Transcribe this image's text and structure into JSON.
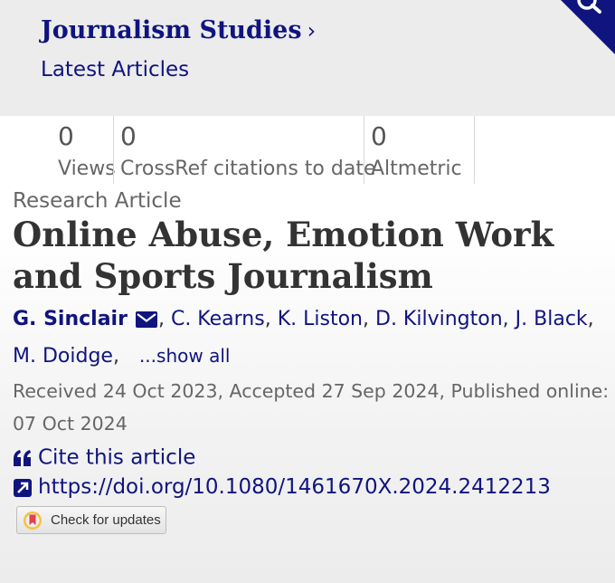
{
  "header": {
    "journal_title": "Journalism Studies",
    "journal_chevron": "›",
    "latest_articles": "Latest Articles"
  },
  "metrics": [
    {
      "value": "0",
      "label": "Views"
    },
    {
      "value": "0",
      "label": "CrossRef citations to date"
    },
    {
      "value": "0",
      "label": "Altmetric"
    }
  ],
  "article": {
    "type": "Research Article",
    "title": "Online Abuse, Emotion Work and Sports Journalism",
    "authors": [
      "G. Sinclair",
      "C. Kearns",
      "K. Liston",
      "D. Kilvington",
      "J. Black",
      "M. Doidge"
    ],
    "separator": ",",
    "show_all": "...show all",
    "dates": "Received 24 Oct 2023, Accepted 27 Sep 2024, Published online: 07 Oct 2024",
    "cite_label": "Cite this article",
    "doi": "https://doi.org/10.1080/1461670X.2024.2412213",
    "check_updates": "Check for updates"
  },
  "icons": {
    "search": "search-icon",
    "mail": "envelope-icon",
    "cite": "quote-icon",
    "doi": "external-link-icon",
    "crossmark": "crossmark-icon"
  },
  "colors": {
    "link": "#10147e",
    "title": "#333333",
    "muted": "#666666",
    "background": "#ececec"
  }
}
